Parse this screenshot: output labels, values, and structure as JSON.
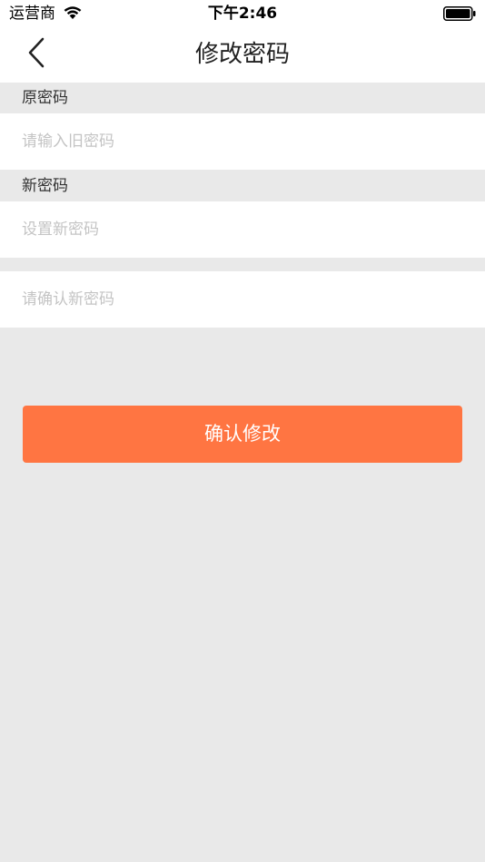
{
  "status_bar": {
    "carrier": "运营商",
    "time": "下午2:46",
    "wifi_icon": "wifi-icon",
    "battery_icon": "battery-icon"
  },
  "nav": {
    "title": "修改密码",
    "back_icon": "chevron-left-icon"
  },
  "form": {
    "old_password_label": "原密码",
    "old_password_placeholder": "请输入旧密码",
    "old_password_value": "",
    "new_password_label": "新密码",
    "new_password_placeholder": "设置新密码",
    "new_password_value": "",
    "confirm_password_placeholder": "请确认新密码",
    "confirm_password_value": ""
  },
  "actions": {
    "confirm_label": "确认修改"
  },
  "colors": {
    "accent": "#ff7542",
    "background": "#e9e9e9",
    "placeholder": "#c4c4c4"
  }
}
